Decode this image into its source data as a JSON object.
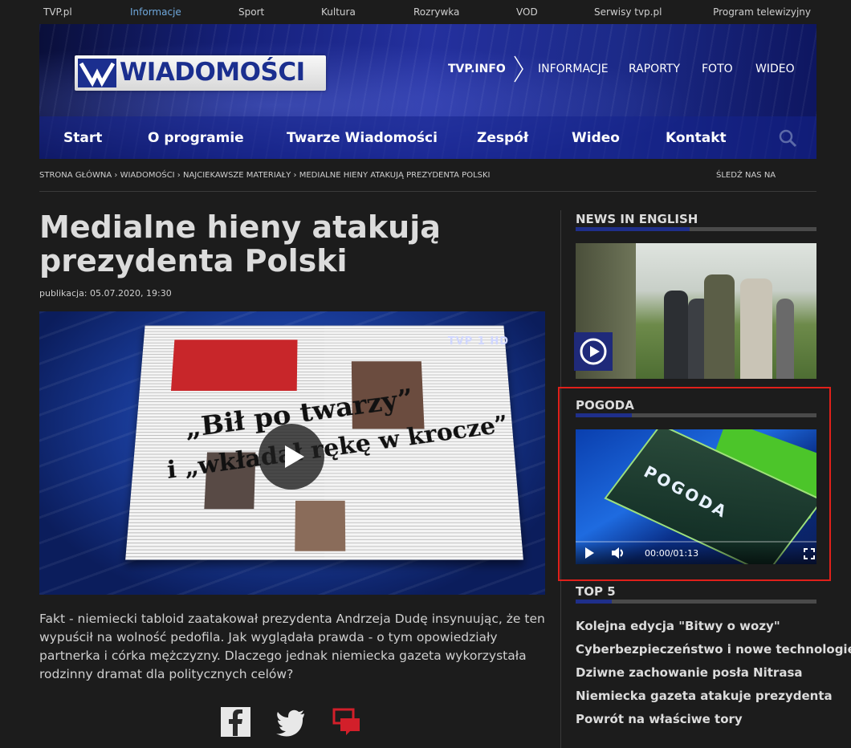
{
  "topbar": {
    "links": [
      "TVP.pl",
      "Informacje",
      "Sport",
      "Kultura",
      "Rozrywka",
      "VOD",
      "Serwisy tvp.pl",
      "Program telewizyjny"
    ]
  },
  "header": {
    "logo_text": "WIADOMOŚCI",
    "brand": "TVP.INFO",
    "nav": [
      "INFORMACJE",
      "RAPORTY",
      "FOTO",
      "WIDEO"
    ]
  },
  "main_nav": [
    "Start",
    "O programie",
    "Twarze Wiadomości",
    "Zespół",
    "Wideo",
    "Kontakt"
  ],
  "breadcrumb": {
    "items": [
      "STRONA GŁÓWNA",
      "WIADOMOŚCI",
      "NAJCIEKAWSZE MATERIAŁY",
      "MEDIALNE HIENY ATAKUJĄ PREZYDENTA POLSKI"
    ],
    "sep": " › ",
    "follow": "ŚLEDŹ NAS NA"
  },
  "article": {
    "title": "Medialne hieny atakują prezydenta Polski",
    "published": "publikacja: 05.07.2020, 19:30",
    "video_badge": "TVP 1 HD",
    "video_headline_1": "„Bił po twarzy”",
    "video_headline_2": "i „wkładał rękę w krocze”",
    "lead": "Fakt - niemiecki tabloid zaatakował prezydenta Andrzeja Dudę insynuując, że ten wypuścił na wolność pedofila. Jak wyglądała prawda - o tym opowiedziały partnerka i córka mężczyzny. Dlaczego jednak niemiecka gazeta wykorzystała rodzinny dramat dla politycznych celów?"
  },
  "sidebar": {
    "news_title": "NEWS IN ENGLISH",
    "pogoda_title": "POGODA",
    "pogoda_video_text": "POGODA",
    "pogoda_time": "00:00/01:13",
    "top5_title": "TOP 5",
    "top5": [
      "Kolejna edycja \"Bitwy o wozy\"",
      "Cyberbezpieczeństwo i nowe technologie",
      "Dziwne zachowanie posła Nitrasa",
      "Niemiecka gazeta atakuje prezydenta",
      "Powrót na właściwe tory"
    ]
  },
  "colors": {
    "accent_blue": "#1f2f8a",
    "highlight_red": "#e0201a",
    "active_top_link": "#6fa8dc"
  }
}
